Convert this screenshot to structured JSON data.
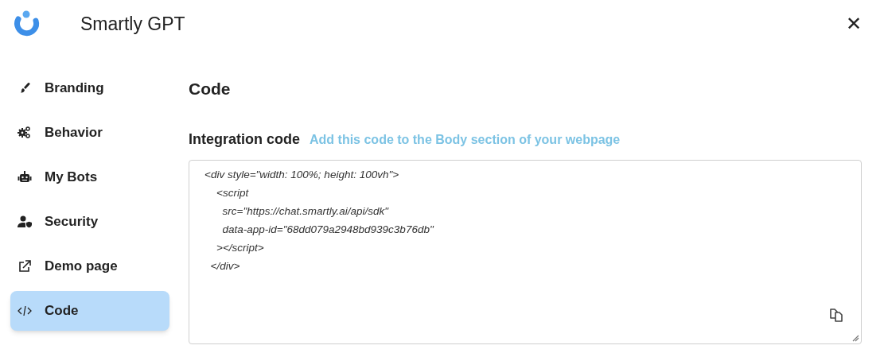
{
  "app": {
    "title": "Smartly GPT",
    "close": "✕"
  },
  "sidebar": {
    "items": [
      {
        "label": "Branding",
        "selected": false
      },
      {
        "label": "Behavior",
        "selected": false
      },
      {
        "label": "My Bots",
        "selected": false
      },
      {
        "label": "Security",
        "selected": false
      },
      {
        "label": "Demo page",
        "selected": false
      },
      {
        "label": "Code",
        "selected": true
      }
    ]
  },
  "main": {
    "heading": "Code",
    "section_label": "Integration code",
    "hint": "Add this code to the Body section of your webpage",
    "code": "<div style=\"width: 100%; height: 100vh\">\n    <script\n      src=\"https://chat.smartly.ai/api/sdk\"\n      data-app-id=\"68dd079a2948bd939c3b76db\"\n    ></script>\n  </div>"
  }
}
